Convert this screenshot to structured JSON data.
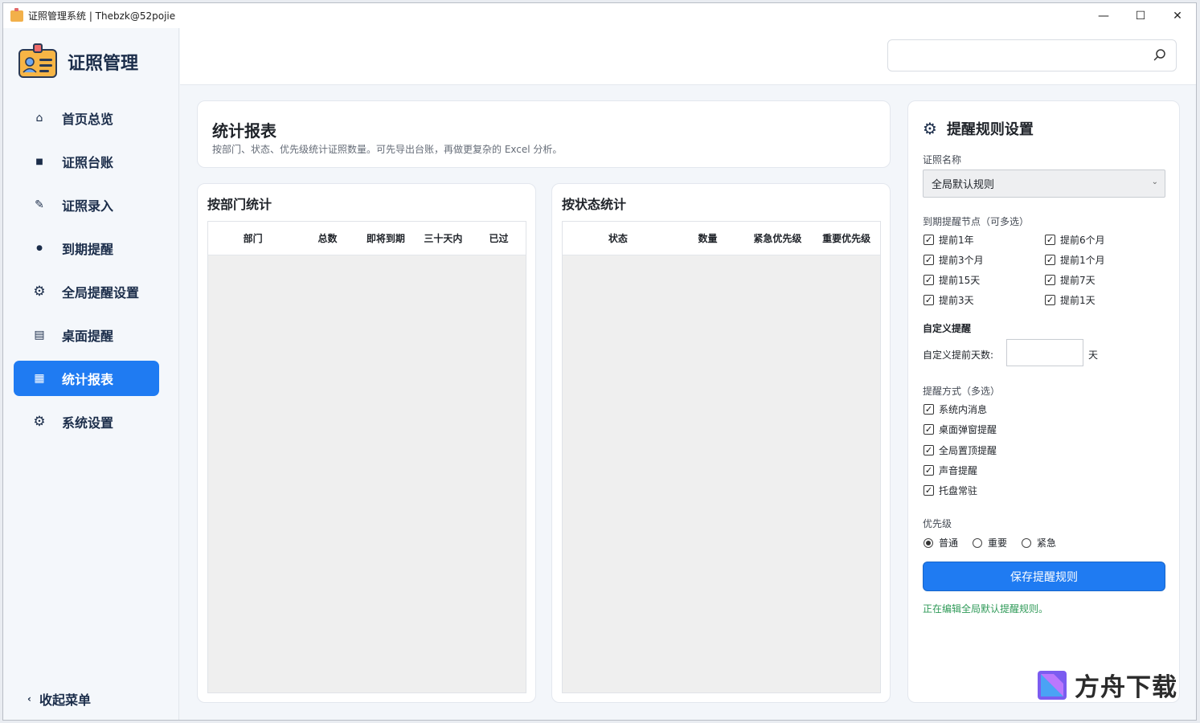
{
  "window": {
    "title": "证照管理系统 | Thebzk@52pojie",
    "controls": {
      "minimize": "—",
      "maximize": "☐",
      "close": "✕"
    }
  },
  "sidebar": {
    "brand": "证照管理",
    "items": [
      {
        "label": "首页总览",
        "icon": "home-icon",
        "glyph": "⌂"
      },
      {
        "label": "证照台账",
        "icon": "ledger-icon",
        "glyph": "◾"
      },
      {
        "label": "证照录入",
        "icon": "pen-icon",
        "glyph": "✎"
      },
      {
        "label": "到期提醒",
        "icon": "dot-icon",
        "glyph": "●"
      },
      {
        "label": "全局提醒设置",
        "icon": "gear-icon",
        "glyph": "⚙"
      },
      {
        "label": "桌面提醒",
        "icon": "list-icon",
        "glyph": "▤"
      },
      {
        "label": "统计报表",
        "icon": "chart-icon",
        "glyph": "▦",
        "active": true
      },
      {
        "label": "系统设置",
        "icon": "gear-icon",
        "glyph": "⚙"
      }
    ],
    "collapse_label": "收起菜单",
    "collapse_glyph": "‹"
  },
  "search": {
    "value": "",
    "placeholder": ""
  },
  "page": {
    "title": "统计报表",
    "subtitle": "按部门、状态、优先级统计证照数量。可先导出台账，再做更复杂的 Excel 分析。"
  },
  "dept_table": {
    "title": "按部门统计",
    "columns": [
      "部门",
      "总数",
      "即将到期",
      "三十天内",
      "已过"
    ],
    "rows": []
  },
  "status_table": {
    "title": "按状态统计",
    "columns": [
      "状态",
      "数量",
      "紧急优先级",
      "重要优先级"
    ],
    "rows": []
  },
  "rules": {
    "title": "提醒规则设置",
    "cert_name_label": "证照名称",
    "cert_name_value": "全局默认规则",
    "nodes_label": "到期提醒节点（可多选）",
    "nodes": [
      {
        "label": "提前1年",
        "checked": true
      },
      {
        "label": "提前6个月",
        "checked": true
      },
      {
        "label": "提前3个月",
        "checked": true
      },
      {
        "label": "提前1个月",
        "checked": true
      },
      {
        "label": "提前15天",
        "checked": true
      },
      {
        "label": "提前7天",
        "checked": true
      },
      {
        "label": "提前3天",
        "checked": true
      },
      {
        "label": "提前1天",
        "checked": true
      }
    ],
    "custom_heading": "自定义提醒",
    "custom_days_label": "自定义提前天数:",
    "custom_days_value": "",
    "custom_days_unit": "天",
    "methods_label": "提醒方式（多选）",
    "methods": [
      {
        "label": "系统内消息",
        "checked": true
      },
      {
        "label": "桌面弹窗提醒",
        "checked": true
      },
      {
        "label": "全局置顶提醒",
        "checked": true
      },
      {
        "label": "声音提醒",
        "checked": true
      },
      {
        "label": "托盘常驻",
        "checked": true
      }
    ],
    "priority_label": "优先级",
    "priorities": [
      {
        "label": "普通",
        "selected": true
      },
      {
        "label": "重要",
        "selected": false
      },
      {
        "label": "紧急",
        "selected": false
      }
    ],
    "save_label": "保存提醒规则",
    "status_message": "正在编辑全局默认提醒规则。"
  },
  "watermark": {
    "text": "方舟下载"
  },
  "colors": {
    "accent": "#1f7bf2",
    "success": "#2f9a58"
  }
}
